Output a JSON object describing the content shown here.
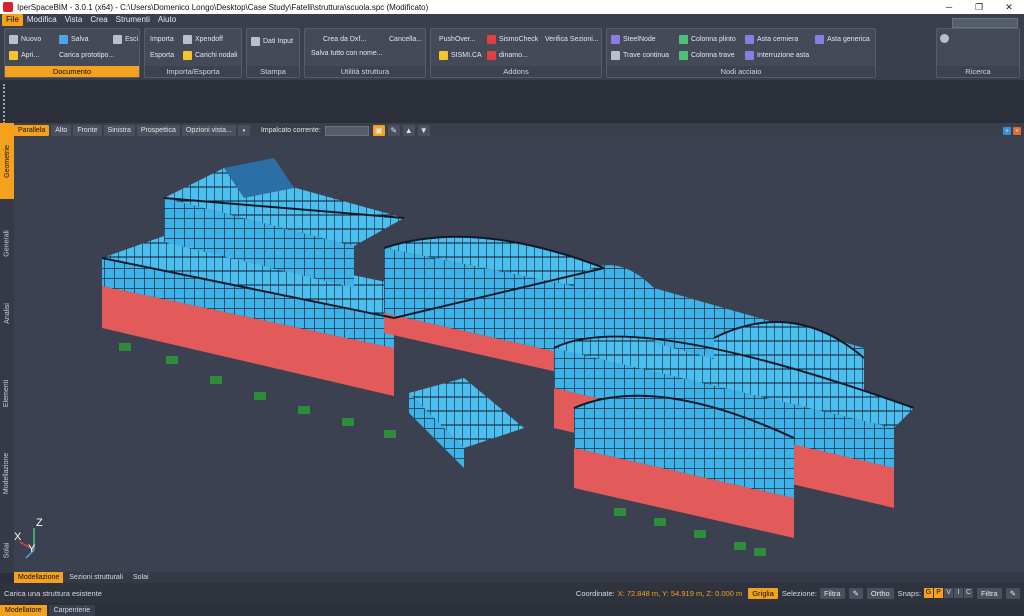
{
  "window": {
    "title": "IperSpaceBIM - 3.0.1 (x64) - C:\\Users\\Domenico Longo\\Desktop\\Case Study\\Fatelli\\struttura\\scuola.spc (Modificato)",
    "minimize": "─",
    "maximize": "❐",
    "close": "✕"
  },
  "menu": [
    "File",
    "Modifica",
    "Vista",
    "Crea",
    "Strumenti",
    "Aiuto"
  ],
  "ribbon": {
    "documento": {
      "caption": "Documento",
      "nuovo": "Nuovo",
      "salva": "Salva",
      "esci": "Esci",
      "apri": "Apri...",
      "carica": "Carica prototipo..."
    },
    "importa_esporta": {
      "caption": "Importa/Esporta",
      "importa": "Importa",
      "esporta": "Esporta",
      "xpendoff": "Xpendoff",
      "carichi": "Carichi nodali"
    },
    "stampa": {
      "caption": "Stampa",
      "dati_input": "Dati Input"
    },
    "utilita": {
      "caption": "Utilità struttura",
      "crea_dxf": "Crea da Dxf...",
      "cancella": "Cancella...",
      "salva_tutto": "Salva tutto con nome..."
    },
    "addons": {
      "caption": "Addons",
      "pushover": "PushOver...",
      "sismocheck": "SismoCheck",
      "verifica": "Verifica Sezioni...",
      "sismica": "SISMI.CA",
      "dinamo": "dinamo..."
    },
    "nodi_acciaio": {
      "caption": "Nodi acciaio",
      "steelnode": "SteelNode",
      "colonna_plinto": "Colonna plinto",
      "asta_cerniera": "Asta cerniera",
      "asta_generica": "Asta generica",
      "trave_continua": "Trave continua",
      "colonna_trave": "Colonna trave",
      "interruzione": "Interruzione asta"
    },
    "ricerca": {
      "caption": "Ricerca"
    }
  },
  "left_tabs": [
    "Geometrie",
    "Generali",
    "Analisi",
    "Elementi",
    "Modellazione",
    "Solai"
  ],
  "view_toolbar": {
    "views": [
      "Parallela",
      "Alto",
      "Fronte",
      "Sinistra",
      "Prospettica"
    ],
    "options": "Opzioni vista...",
    "impalcato_label": "Impalcato corrente:"
  },
  "axes": {
    "x": "X",
    "y": "Y",
    "z": "Z"
  },
  "bottom_tabs": [
    "Modellazione",
    "Sezioni strutturali",
    "Solai"
  ],
  "status": {
    "message": "Carica una struttura esistente",
    "coord_label": "Coordinate:",
    "coords": "X: 72.848 m, Y: 54.919 m, Z: 0.000 m",
    "griglia": "Griglia",
    "selezione_label": "Selezione:",
    "filtra": "Filtra",
    "ortho": "Ortho",
    "snaps_label": "Snaps:",
    "snaps": [
      "G",
      "P",
      "V",
      "I",
      "C"
    ],
    "filtra2": "Filtra"
  },
  "footer_tabs": [
    "Modellatore",
    "Carpenterie"
  ],
  "colors": {
    "accent": "#f4a11d",
    "beam": "#0d1a2a",
    "panel": "#3fb3e8",
    "wall": "#e25a5a",
    "plinth": "#2f8a3c",
    "column": "#efe3a0"
  }
}
